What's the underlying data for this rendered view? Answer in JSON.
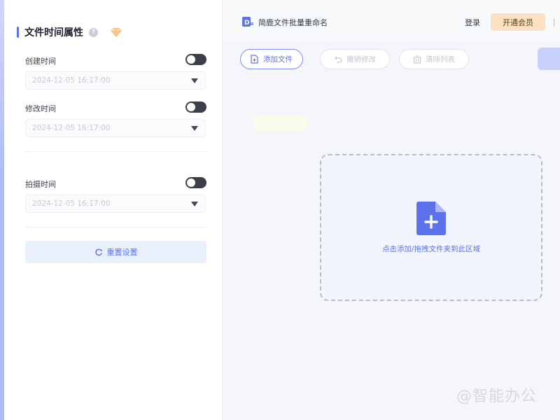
{
  "sidebar": {
    "title": "文件时间属性",
    "fields": [
      {
        "label": "创建时间",
        "value": "2024-12-05 16:17:00",
        "enabled": false
      },
      {
        "label": "修改时间",
        "value": "2024-12-05 16:17:00",
        "enabled": false
      },
      {
        "label": "拍摄时间",
        "value": "2024-12-05 16:17:00",
        "enabled": false
      }
    ],
    "reset_label": "重置设置"
  },
  "topbar": {
    "app_name": "简鹿文件批量重命名",
    "login_label": "登录",
    "vip_label": "开通会员"
  },
  "toolbar": {
    "add_files_label": "添加文件",
    "undo_label": "撤销修改",
    "clear_label": "清除列表"
  },
  "dropzone": {
    "hint": "点击添加/拖拽文件夹到此区域"
  },
  "watermark": "@智能办公",
  "colors": {
    "accent": "#5b72ec",
    "vip_button": "#fde2c2",
    "toggle_off": "#3b3f4a",
    "dropzone_bg": "#f3f5fc"
  },
  "icons": {
    "title_help": "help-circle-icon",
    "title_vip": "vip-gem-icon",
    "add_files": "file-plus-icon",
    "undo": "undo-icon",
    "clear": "clear-list-icon",
    "reset": "refresh-icon",
    "dropzone": "file-add-icon",
    "select_caret": "caret-down-icon"
  }
}
